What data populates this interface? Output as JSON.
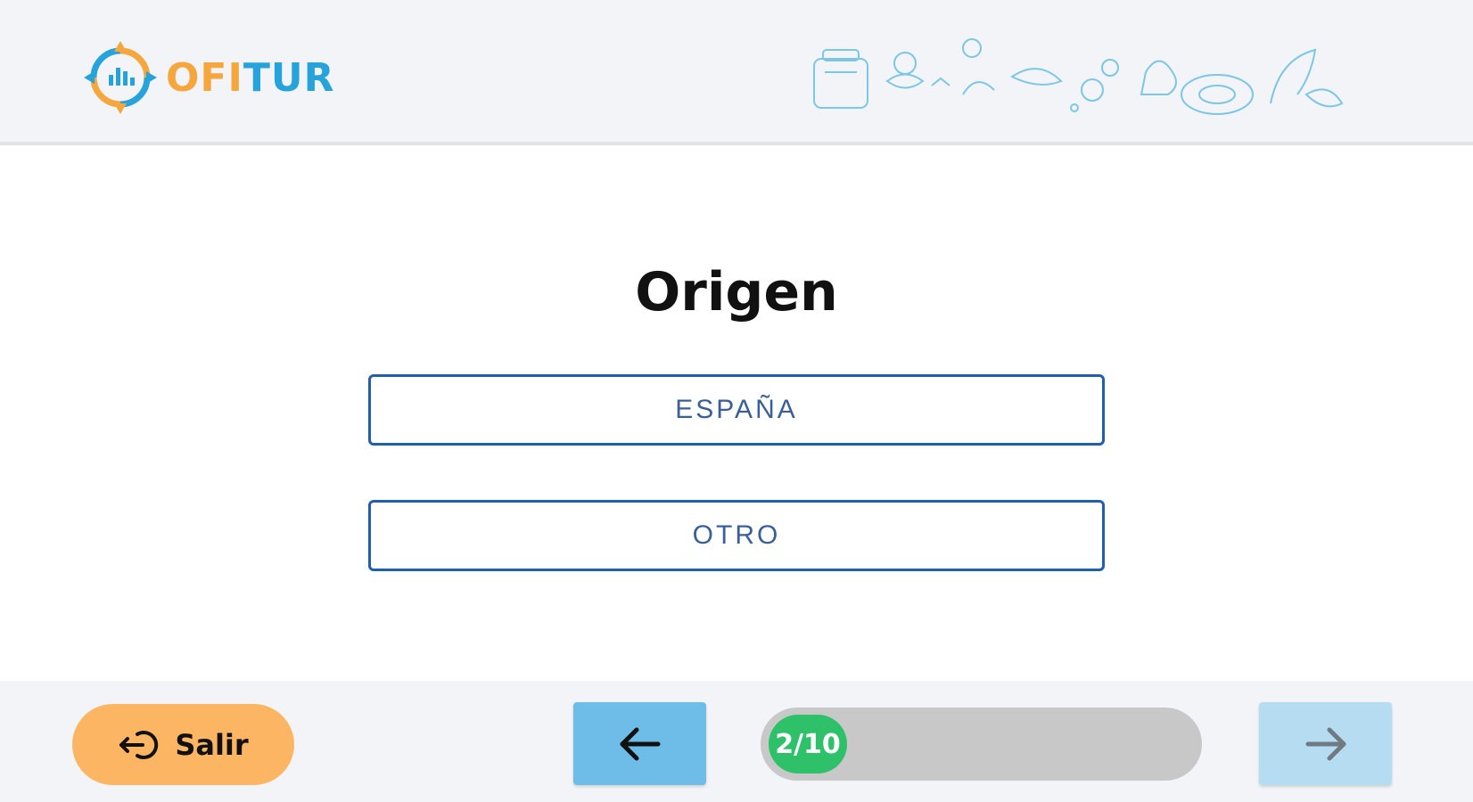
{
  "header": {
    "logo_part_a": "OFI",
    "logo_part_b": "TUR"
  },
  "main": {
    "title": "Origen",
    "options": [
      {
        "label": "ESPAÑA"
      },
      {
        "label": "OTRO"
      }
    ]
  },
  "footer": {
    "exit_label": "Salir",
    "progress_text": "2/10",
    "progress_fraction": 0.2
  },
  "icons": {
    "logo": "ofitur-logo-icon",
    "decoration": "travel-doodles-icon",
    "exit": "exit-icon",
    "prev": "arrow-left-icon",
    "next": "arrow-right-icon"
  },
  "colors": {
    "accent_orange": "#fcb563",
    "accent_blue": "#27a3dc",
    "option_border": "#1f5fae",
    "prev_bg": "#6ebde8",
    "next_bg_disabled": "#b6dcf2",
    "progress_green": "#2ec16a"
  }
}
